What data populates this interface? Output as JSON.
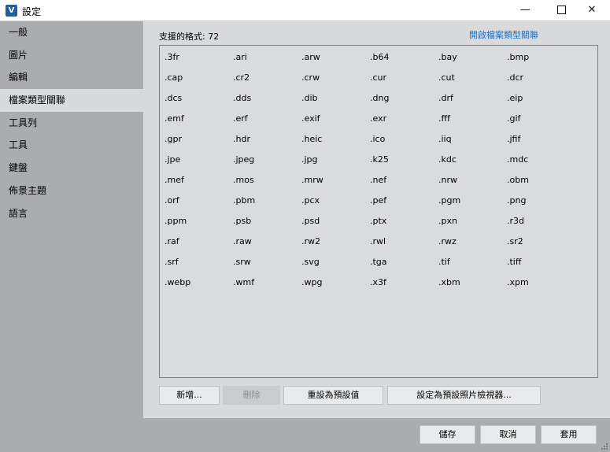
{
  "window": {
    "title": "設定",
    "app_icon_glyph": "V",
    "minimize": "—",
    "close": "✕"
  },
  "sidebar": {
    "items": [
      {
        "label": "一般",
        "selected": false
      },
      {
        "label": "圖片",
        "selected": false
      },
      {
        "label": "編輯",
        "selected": false
      },
      {
        "label": "檔案類型關聯",
        "selected": true
      },
      {
        "label": "工具列",
        "selected": false
      },
      {
        "label": "工具",
        "selected": false
      },
      {
        "label": "鍵盤",
        "selected": false
      },
      {
        "label": "佈景主題",
        "selected": false
      },
      {
        "label": "語言",
        "selected": false
      }
    ]
  },
  "main": {
    "formats_label": "支援的格式: 72",
    "open_assoc_link": "開啟檔案類型關聯",
    "formats": [
      ".3fr",
      ".ari",
      ".arw",
      ".b64",
      ".bay",
      ".bmp",
      ".cap",
      ".cr2",
      ".crw",
      ".cur",
      ".cut",
      ".dcr",
      ".dcs",
      ".dds",
      ".dib",
      ".dng",
      ".drf",
      ".eip",
      ".emf",
      ".erf",
      ".exif",
      ".exr",
      ".fff",
      ".gif",
      ".gpr",
      ".hdr",
      ".heic",
      ".ico",
      ".iiq",
      ".jfif",
      ".jpe",
      ".jpeg",
      ".jpg",
      ".k25",
      ".kdc",
      ".mdc",
      ".mef",
      ".mos",
      ".mrw",
      ".nef",
      ".nrw",
      ".obm",
      ".orf",
      ".pbm",
      ".pcx",
      ".pef",
      ".pgm",
      ".png",
      ".ppm",
      ".psb",
      ".psd",
      ".ptx",
      ".pxn",
      ".r3d",
      ".raf",
      ".raw",
      ".rw2",
      ".rwl",
      ".rwz",
      ".sr2",
      ".srf",
      ".srw",
      ".svg",
      ".tga",
      ".tif",
      ".tiff",
      ".webp",
      ".wmf",
      ".wpg",
      ".x3f",
      ".xbm",
      ".xpm"
    ],
    "buttons": {
      "new": "新增...",
      "delete": "刪除",
      "reset": "重設為預設值",
      "set_default": "設定為預設照片檢視器..."
    }
  },
  "footer": {
    "save": "儲存",
    "cancel": "取消",
    "apply": "套用"
  },
  "colors": {
    "accent_link": "#1a73d1",
    "sidebar_bg": "#a9adb0",
    "content_bg": "#d8dadc"
  }
}
